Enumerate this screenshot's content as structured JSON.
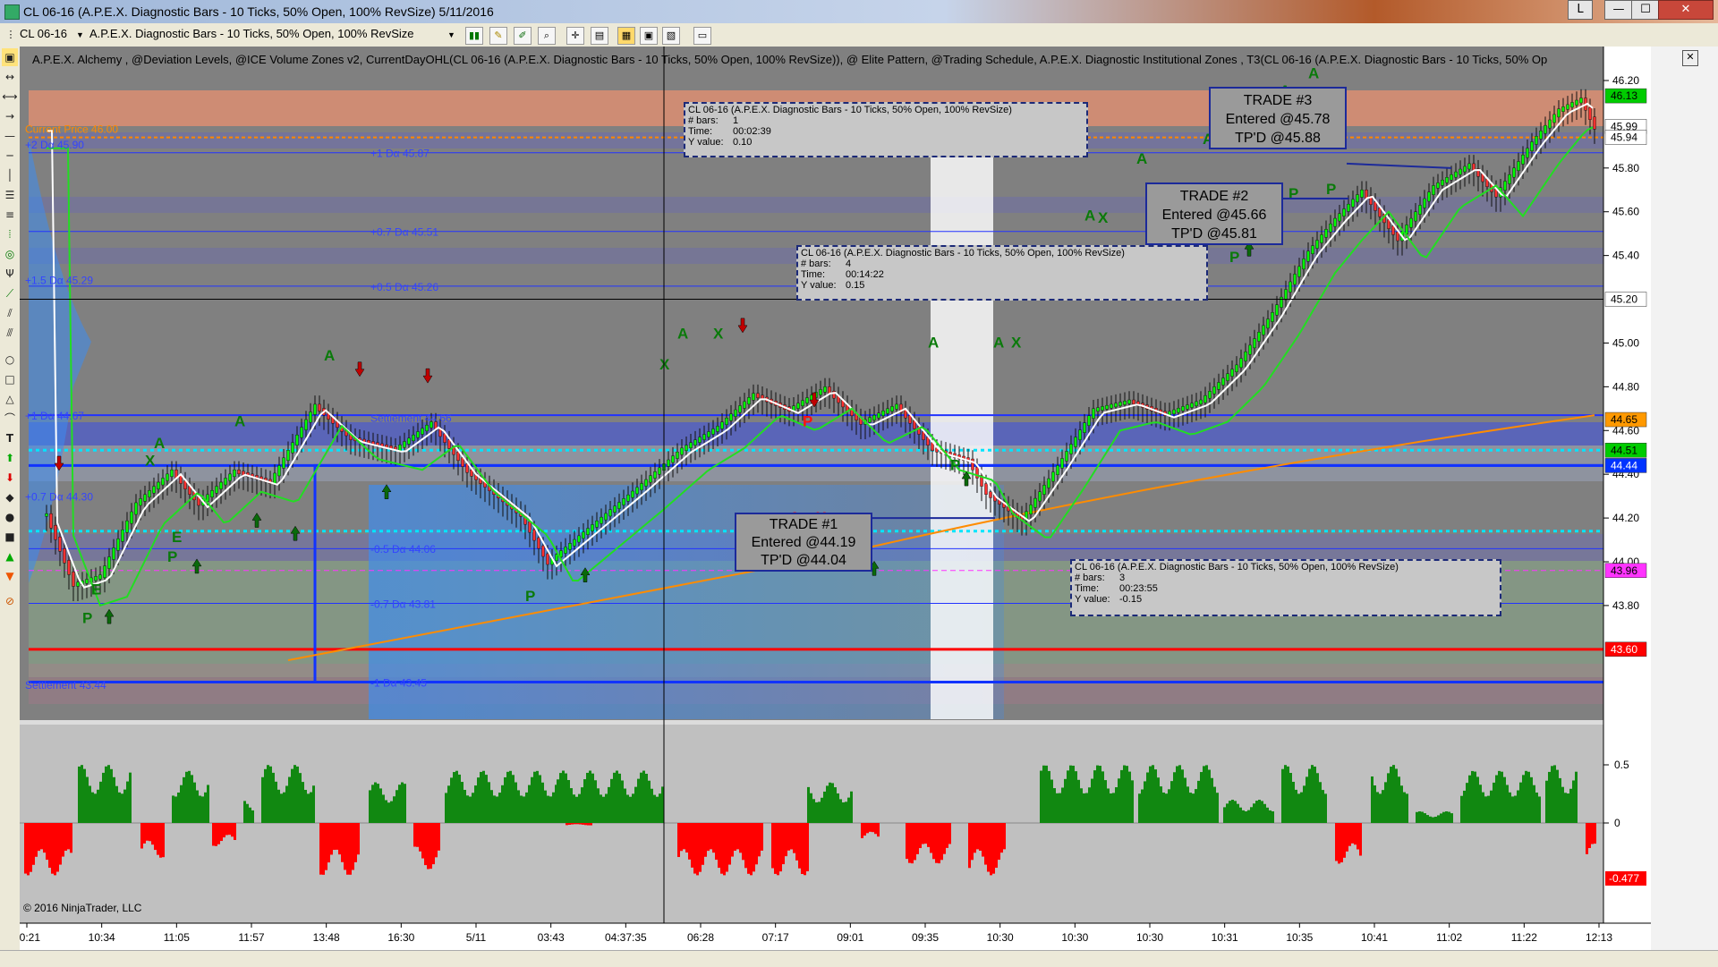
{
  "window": {
    "title": "CL 06-16 (A.P.E.X. Diagnostic Bars - 10 Ticks, 50% Open, 100% RevSize)  5/11/2016",
    "btn_layout": "L",
    "btn_min": "—",
    "btn_max": "☐",
    "btn_close": "✕"
  },
  "toolbar": {
    "instrument": "CL 06-16",
    "bar_type": "A.P.E.X. Diagnostic Bars - 10 Ticks, 50% Open, 100% RevSize"
  },
  "indicators_label": "A.P.E.X. Alchemy , @Deviation Levels, @ICE Volume Zones v2, CurrentDayOHL(CL 06-16 (A.P.E.X. Diagnostic Bars - 10 Ticks, 50% Open, 100% RevSize)), @ Elite Pattern, @Trading Schedule, A.P.E.X. Diagnostic Institutional Zones , T3(CL 06-16 (A.P.E.X. Diagnostic Bars - 10 Ticks, 50% Op",
  "price_axis": {
    "ticks": [
      "46.20",
      "45.80",
      "45.60",
      "45.40",
      "45.00",
      "44.80",
      "44.60",
      "44.40",
      "44.20",
      "44.00",
      "43.80"
    ],
    "markers": [
      {
        "label": "46.13",
        "color": "#00cc00"
      },
      {
        "label": "45.99",
        "color": "#ffffff"
      },
      {
        "label": "45.94",
        "color": "#ffffff"
      },
      {
        "label": "45.20",
        "color": "#ffffff"
      },
      {
        "label": "44.65",
        "color": "#ff9900"
      },
      {
        "label": "44.51",
        "color": "#00cc00"
      },
      {
        "label": "44.44",
        "color": "#0033ff"
      },
      {
        "label": "43.96",
        "color": "#ff33ff"
      },
      {
        "label": "43.60",
        "color": "#ff0000"
      }
    ]
  },
  "osc_axis": {
    "ticks": [
      "0.5",
      "0"
    ],
    "marker": {
      "label": "-0.477",
      "color": "#ff0000"
    }
  },
  "time_axis": [
    "10:21",
    "10:34",
    "11:05",
    "11:57",
    "13:48",
    "16:30",
    "5/11",
    "03:43",
    "04:37:35",
    "06:28",
    "07:17",
    "09:01",
    "09:35",
    "10:30",
    "10:30",
    "10:30",
    "10:31",
    "10:35",
    "10:41",
    "11:02",
    "11:22",
    "12:13"
  ],
  "level_labels": [
    {
      "text": "Current Price 46.00",
      "color": "#ff8800"
    },
    {
      "text": "+2 Dα 45.90",
      "color": "#3344ff"
    },
    {
      "text": "+1 Dα 45.87",
      "color": "#3344ff"
    },
    {
      "text": "+0.7 Dα 45.51",
      "color": "#3344ff"
    },
    {
      "text": "+1.5 Dα 45.29",
      "color": "#3344ff"
    },
    {
      "text": "+0.5 Dα 45.26",
      "color": "#3344ff"
    },
    {
      "text": "+1 Dα 44.67",
      "color": "#3344ff"
    },
    {
      "text": "Settlement 44.66",
      "color": "#3344ff"
    },
    {
      "text": "+0.7 Dα 44.30",
      "color": "#3344ff"
    },
    {
      "text": "-0.5 Dα 44.06",
      "color": "#3344ff"
    },
    {
      "text": "-0.7 Dα 43.81",
      "color": "#3344ff"
    },
    {
      "text": "-1 Dα 43.45",
      "color": "#3344ff"
    },
    {
      "text": "Settlement 43.44",
      "color": "#3344ff"
    }
  ],
  "info_boxes": [
    {
      "title": "CL 06-16 (A.P.E.X. Diagnostic Bars - 10 Ticks, 50% Open, 100% RevSize)",
      "bars_label": "# bars:",
      "bars": "1",
      "time_label": "Time:",
      "time": "00:02:39",
      "y_label": "Y value:",
      "y": "0.10"
    },
    {
      "title": "CL 06-16 (A.P.E.X. Diagnostic Bars - 10 Ticks, 50% Open, 100% RevSize)",
      "bars_label": "# bars:",
      "bars": "4",
      "time_label": "Time:",
      "time": "00:14:22",
      "y_label": "Y value:",
      "y": "0.15"
    },
    {
      "title": "CL 06-16 (A.P.E.X. Diagnostic Bars - 10 Ticks, 50% Open, 100% RevSize)",
      "bars_label": "# bars:",
      "bars": "3",
      "time_label": "Time:",
      "time": "00:23:55",
      "y_label": "Y value:",
      "y": "-0.15"
    }
  ],
  "trades": [
    {
      "line1": "TRADE #1",
      "line2": "Entered @44.19",
      "line3": "TP'D @44.04"
    },
    {
      "line1": "TRADE #2",
      "line2": "Entered @45.66",
      "line3": "TP'D @45.81"
    },
    {
      "line1": "TRADE #3",
      "line2": "Entered @45.78",
      "line3": "TP'D @45.88"
    }
  ],
  "copyright": "© 2016 NinjaTrader, LLC",
  "colors": {
    "chart_bg": "#808080",
    "osc_bg": "#c0c0c0",
    "up": "#00ff00",
    "down": "#ff0000",
    "blue_zone": "#4f7fd0",
    "level": "#2233ff"
  },
  "icons": [
    "menu-icon",
    "drawing-tools-icon",
    "zoom-icon",
    "properties-icon",
    "crosshair-icon",
    "arrow-up-icon",
    "arrow-down-icon",
    "line-icon",
    "ray-icon",
    "rectangle-icon",
    "ellipse-icon",
    "triangle-icon",
    "text-icon",
    "fibonacci-icon",
    "andrews-pitchfork-icon",
    "close-icon"
  ]
}
